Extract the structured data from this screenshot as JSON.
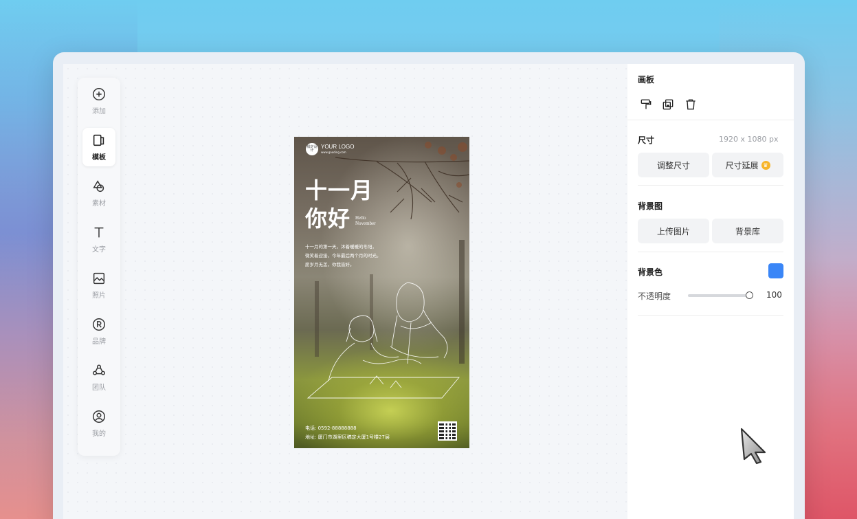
{
  "colors": {
    "accent": "#3a86f7",
    "bg_color_swatch": "#3a86f7",
    "premium_badge": "#f7b52a"
  },
  "rail": {
    "items": [
      {
        "label": "添加",
        "icon": "plus-circle-icon"
      },
      {
        "label": "模板",
        "icon": "template-icon",
        "active": true
      },
      {
        "label": "素材",
        "icon": "shapes-icon"
      },
      {
        "label": "文字",
        "icon": "text-icon"
      },
      {
        "label": "照片",
        "icon": "image-icon"
      },
      {
        "label": "品牌",
        "icon": "registered-icon"
      },
      {
        "label": "团队",
        "icon": "team-icon"
      },
      {
        "label": "我的",
        "icon": "user-icon"
      }
    ]
  },
  "poster": {
    "logo_badge": "橘定设计",
    "logo_text": "YOUR LOGO",
    "logo_url": "www.gaoding.com",
    "title_line1": "十一月",
    "title_line2": "你好",
    "hello_line1": "Hello",
    "hello_line2": "November",
    "body": [
      "十一月的第一天，沐着暖暖的冬阳，",
      "微笑着迎接，今年最后两个月的时光。",
      "愿岁月无恙，你我皆好。"
    ],
    "phone": "电话: 0592-88888888",
    "address": "地址: 厦门市湖里区稿定大厦1号楼27层"
  },
  "panel": {
    "artboard_title": "画板",
    "toolbar_icons": [
      "format-painter-icon",
      "duplicate-icon",
      "trash-icon"
    ],
    "size_label": "尺寸",
    "size_value": "1920 x 1080 px",
    "resize_button": "调整尺寸",
    "extend_button": "尺寸延展",
    "bg_image_label": "背景图",
    "upload_button": "上传图片",
    "library_button": "背景库",
    "bg_color_label": "背景色",
    "opacity_label": "不透明度",
    "opacity_value": "100",
    "opacity_fraction": 1.0
  }
}
